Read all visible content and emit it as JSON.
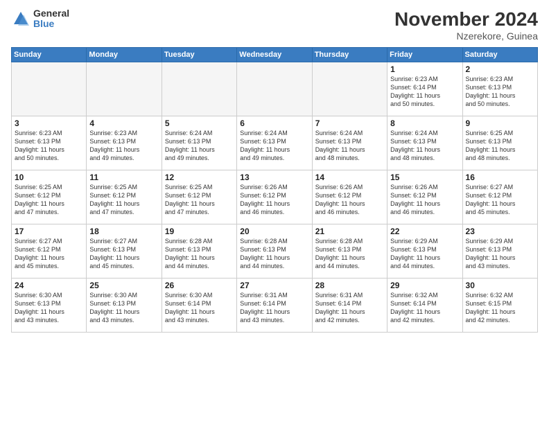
{
  "logo": {
    "general": "General",
    "blue": "Blue"
  },
  "header": {
    "month": "November 2024",
    "location": "Nzerekore, Guinea"
  },
  "weekdays": [
    "Sunday",
    "Monday",
    "Tuesday",
    "Wednesday",
    "Thursday",
    "Friday",
    "Saturday"
  ],
  "weeks": [
    [
      {
        "day": "",
        "text": "",
        "empty": true
      },
      {
        "day": "",
        "text": "",
        "empty": true
      },
      {
        "day": "",
        "text": "",
        "empty": true
      },
      {
        "day": "",
        "text": "",
        "empty": true
      },
      {
        "day": "",
        "text": "",
        "empty": true
      },
      {
        "day": "1",
        "text": "Sunrise: 6:23 AM\nSunset: 6:14 PM\nDaylight: 11 hours\nand 50 minutes.",
        "empty": false
      },
      {
        "day": "2",
        "text": "Sunrise: 6:23 AM\nSunset: 6:13 PM\nDaylight: 11 hours\nand 50 minutes.",
        "empty": false
      }
    ],
    [
      {
        "day": "3",
        "text": "Sunrise: 6:23 AM\nSunset: 6:13 PM\nDaylight: 11 hours\nand 50 minutes.",
        "empty": false
      },
      {
        "day": "4",
        "text": "Sunrise: 6:23 AM\nSunset: 6:13 PM\nDaylight: 11 hours\nand 49 minutes.",
        "empty": false
      },
      {
        "day": "5",
        "text": "Sunrise: 6:24 AM\nSunset: 6:13 PM\nDaylight: 11 hours\nand 49 minutes.",
        "empty": false
      },
      {
        "day": "6",
        "text": "Sunrise: 6:24 AM\nSunset: 6:13 PM\nDaylight: 11 hours\nand 49 minutes.",
        "empty": false
      },
      {
        "day": "7",
        "text": "Sunrise: 6:24 AM\nSunset: 6:13 PM\nDaylight: 11 hours\nand 48 minutes.",
        "empty": false
      },
      {
        "day": "8",
        "text": "Sunrise: 6:24 AM\nSunset: 6:13 PM\nDaylight: 11 hours\nand 48 minutes.",
        "empty": false
      },
      {
        "day": "9",
        "text": "Sunrise: 6:25 AM\nSunset: 6:13 PM\nDaylight: 11 hours\nand 48 minutes.",
        "empty": false
      }
    ],
    [
      {
        "day": "10",
        "text": "Sunrise: 6:25 AM\nSunset: 6:12 PM\nDaylight: 11 hours\nand 47 minutes.",
        "empty": false
      },
      {
        "day": "11",
        "text": "Sunrise: 6:25 AM\nSunset: 6:12 PM\nDaylight: 11 hours\nand 47 minutes.",
        "empty": false
      },
      {
        "day": "12",
        "text": "Sunrise: 6:25 AM\nSunset: 6:12 PM\nDaylight: 11 hours\nand 47 minutes.",
        "empty": false
      },
      {
        "day": "13",
        "text": "Sunrise: 6:26 AM\nSunset: 6:12 PM\nDaylight: 11 hours\nand 46 minutes.",
        "empty": false
      },
      {
        "day": "14",
        "text": "Sunrise: 6:26 AM\nSunset: 6:12 PM\nDaylight: 11 hours\nand 46 minutes.",
        "empty": false
      },
      {
        "day": "15",
        "text": "Sunrise: 6:26 AM\nSunset: 6:12 PM\nDaylight: 11 hours\nand 46 minutes.",
        "empty": false
      },
      {
        "day": "16",
        "text": "Sunrise: 6:27 AM\nSunset: 6:12 PM\nDaylight: 11 hours\nand 45 minutes.",
        "empty": false
      }
    ],
    [
      {
        "day": "17",
        "text": "Sunrise: 6:27 AM\nSunset: 6:12 PM\nDaylight: 11 hours\nand 45 minutes.",
        "empty": false
      },
      {
        "day": "18",
        "text": "Sunrise: 6:27 AM\nSunset: 6:13 PM\nDaylight: 11 hours\nand 45 minutes.",
        "empty": false
      },
      {
        "day": "19",
        "text": "Sunrise: 6:28 AM\nSunset: 6:13 PM\nDaylight: 11 hours\nand 44 minutes.",
        "empty": false
      },
      {
        "day": "20",
        "text": "Sunrise: 6:28 AM\nSunset: 6:13 PM\nDaylight: 11 hours\nand 44 minutes.",
        "empty": false
      },
      {
        "day": "21",
        "text": "Sunrise: 6:28 AM\nSunset: 6:13 PM\nDaylight: 11 hours\nand 44 minutes.",
        "empty": false
      },
      {
        "day": "22",
        "text": "Sunrise: 6:29 AM\nSunset: 6:13 PM\nDaylight: 11 hours\nand 44 minutes.",
        "empty": false
      },
      {
        "day": "23",
        "text": "Sunrise: 6:29 AM\nSunset: 6:13 PM\nDaylight: 11 hours\nand 43 minutes.",
        "empty": false
      }
    ],
    [
      {
        "day": "24",
        "text": "Sunrise: 6:30 AM\nSunset: 6:13 PM\nDaylight: 11 hours\nand 43 minutes.",
        "empty": false
      },
      {
        "day": "25",
        "text": "Sunrise: 6:30 AM\nSunset: 6:13 PM\nDaylight: 11 hours\nand 43 minutes.",
        "empty": false
      },
      {
        "day": "26",
        "text": "Sunrise: 6:30 AM\nSunset: 6:14 PM\nDaylight: 11 hours\nand 43 minutes.",
        "empty": false
      },
      {
        "day": "27",
        "text": "Sunrise: 6:31 AM\nSunset: 6:14 PM\nDaylight: 11 hours\nand 43 minutes.",
        "empty": false
      },
      {
        "day": "28",
        "text": "Sunrise: 6:31 AM\nSunset: 6:14 PM\nDaylight: 11 hours\nand 42 minutes.",
        "empty": false
      },
      {
        "day": "29",
        "text": "Sunrise: 6:32 AM\nSunset: 6:14 PM\nDaylight: 11 hours\nand 42 minutes.",
        "empty": false
      },
      {
        "day": "30",
        "text": "Sunrise: 6:32 AM\nSunset: 6:15 PM\nDaylight: 11 hours\nand 42 minutes.",
        "empty": false
      }
    ]
  ]
}
